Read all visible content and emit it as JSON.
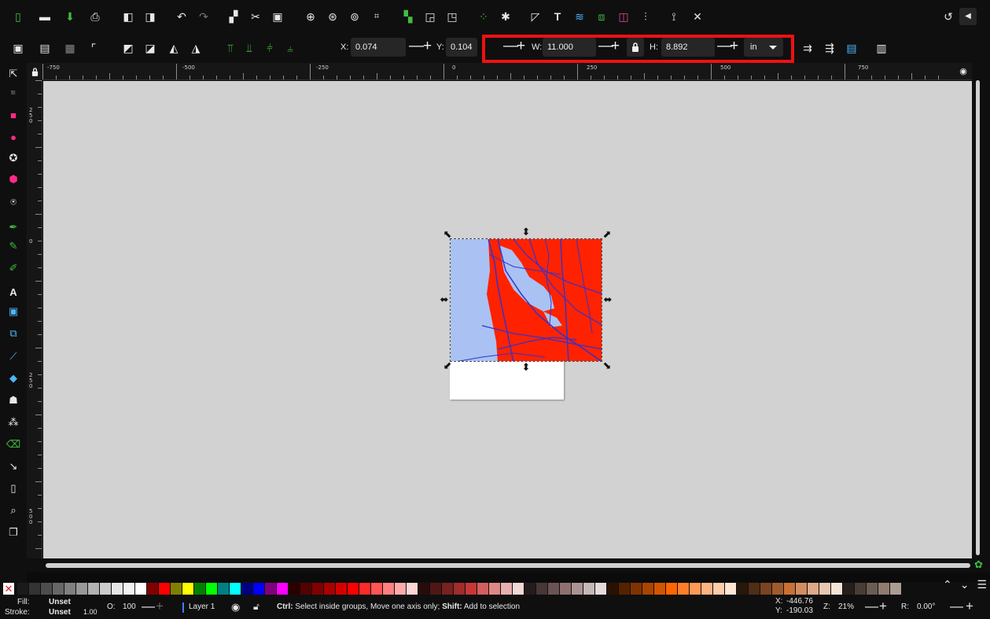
{
  "controls": {
    "x_label": "X:",
    "x_value": "0.074",
    "y_label": "Y:",
    "y_value": "0.104",
    "w_label": "W:",
    "w_value": "11.000",
    "h_label": "H:",
    "h_value": "8.892",
    "unit": "in",
    "minus": "—",
    "plus": "+"
  },
  "ruler": {
    "top_labels": [
      "-750",
      "-500",
      "-250",
      "0",
      "250",
      "500",
      "750"
    ],
    "left_labels": [
      "250",
      "0",
      "250",
      "500"
    ]
  },
  "canvas": {
    "background": "#d2d2d2"
  },
  "map": {
    "land_color": "#ff2200",
    "water_color": "#a9c2f3",
    "road_color": "#3333cc"
  },
  "status": {
    "fill_label": "Fill:",
    "fill_value": "Unset",
    "stroke_label": "Stroke:",
    "stroke_value": "Unset",
    "stroke_width": "1.00",
    "opacity_label": "O:",
    "opacity_value": "100",
    "layer": "Layer 1",
    "message_ctrl": "Ctrl:",
    "message_ctrl_text": " Select inside groups, Move one axis only; ",
    "message_shift": "Shift:",
    "message_shift_text": " Add to selection",
    "cursor_x_label": "X:",
    "cursor_x": "-446.76",
    "cursor_y_label": "Y:",
    "cursor_y": "-190.03",
    "zoom_label": "Z:",
    "zoom": "21%",
    "rotation_label": "R:",
    "rotation": "0.00°"
  },
  "icons": {
    "top_row": [
      "new-document-icon",
      "open-icon",
      "save-icon",
      "print-icon",
      "import-icon",
      "export-icon",
      "undo-icon",
      "redo-icon",
      "duplicate-icon",
      "cut-icon",
      "paste-icon",
      "zoom-selection-icon",
      "zoom-drawing-icon",
      "zoom-page-icon",
      "zoom-center-icon",
      "group-icon",
      "ungroup-icon",
      "clone-icon",
      "node-editor-icon",
      "snap-icon",
      "xml-editor-icon",
      "text-icon",
      "layers-icon",
      "objects-icon",
      "swatches-icon",
      "align-icon",
      "preferences-icon",
      "symbols-icon",
      "settings-icon",
      "reset-icon",
      "collapse-icon"
    ],
    "tools": [
      "selector-tool-icon",
      "node-tool-icon",
      "rectangle-tool-icon",
      "ellipse-tool-icon",
      "star-tool-icon",
      "3d-box-tool-icon",
      "spiral-tool-icon",
      "pen-tool-icon",
      "pencil-tool-icon",
      "calligraphy-tool-icon",
      "text-tool-icon",
      "gradient-tool-icon",
      "mesh-tool-icon",
      "dropper-tool-icon",
      "paint-bucket-tool-icon",
      "tweak-tool-icon",
      "spray-tool-icon",
      "eraser-tool-icon",
      "connector-tool-icon",
      "pages-tool-icon",
      "zoom-tool-icon",
      "measure-tool-icon"
    ]
  },
  "palette": [
    "#1a1a1a",
    "#333333",
    "#4d4d4d",
    "#666666",
    "#808080",
    "#999999",
    "#b3b3b3",
    "#cccccc",
    "#e6e6e6",
    "#f2f2f2",
    "#ffffff",
    "#800000",
    "#ff0000",
    "#808000",
    "#ffff00",
    "#008000",
    "#00ff00",
    "#008080",
    "#00ffff",
    "#000080",
    "#0000ff",
    "#800080",
    "#ff00ff",
    "#2b0000",
    "#550000",
    "#800000",
    "#aa0000",
    "#d40000",
    "#ff0000",
    "#ff2a2a",
    "#ff5555",
    "#ff8080",
    "#ffaaaa",
    "#ffd5d5",
    "#280b0b",
    "#501616",
    "#782121",
    "#a02c2c",
    "#c83737",
    "#d35f5f",
    "#de8787",
    "#e9afaf",
    "#f4d7d7",
    "#241c1c",
    "#483737",
    "#6c5353",
    "#916f6f",
    "#ac9393",
    "#c8b7b7",
    "#e3dbdb",
    "#2b1100",
    "#552200",
    "#803300",
    "#aa4400",
    "#d45500",
    "#ff6600",
    "#ff7f2a",
    "#ff9955",
    "#ffb380",
    "#ffccaa",
    "#ffe6d5",
    "#28170b",
    "#502d16",
    "#784421",
    "#a05a2c",
    "#c87137",
    "#d38d5f",
    "#deaa87",
    "#e9c6af",
    "#f4e3d7",
    "#241f1c",
    "#483e37",
    "#6c5d53",
    "#917c6f",
    "#ac9d93"
  ]
}
